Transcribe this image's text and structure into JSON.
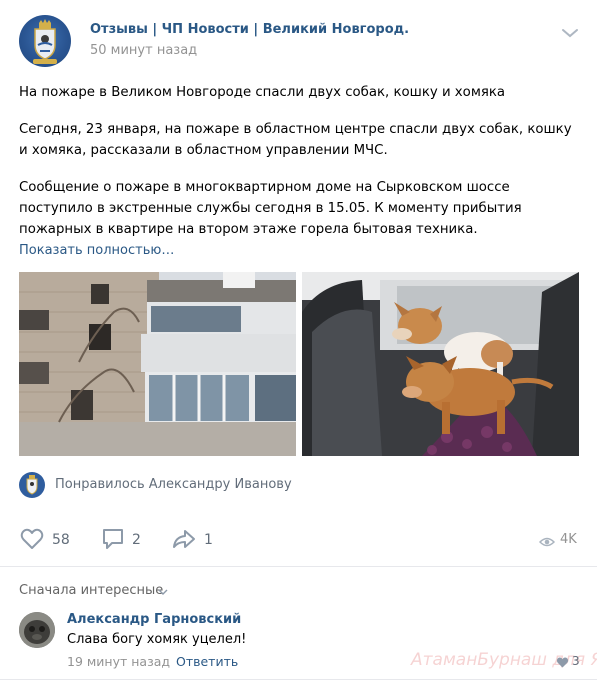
{
  "post": {
    "group_name": "Отзывы | ЧП Новости | Великий Новгород.",
    "time": "50 минут назад",
    "paragraphs": [
      "На пожаре в Великом Новгороде спасли двух собак, кошку и хомяка",
      "Сегодня, 23 января, на пожаре в областном центре спасли двух собак, кошку и хомяка, рассказали в областном управлении МЧС.",
      "Сообщение о пожаре в многоквартирном доме на Сырковском шоссе поступило в экстренные службы сегодня в 15.05. К моменту прибытия пожарных в квартире на втором этаже горела бытовая техника."
    ],
    "show_more": "Показать полностью…",
    "photos": [
      {
        "icon": "burned-building-photo"
      },
      {
        "icon": "dogs-in-car-photo"
      }
    ],
    "liked_by": "Понравилось Александру Иванову"
  },
  "actions": {
    "likes": "58",
    "comments": "2",
    "shares": "1",
    "views": "4K"
  },
  "comments": {
    "sort_label": "Сначала интересные",
    "items": [
      {
        "author": "Александр Гарновский",
        "text": "Слава богу хомяк уцелел!",
        "time": "19 минут назад",
        "reply": "Ответить",
        "likes": "3"
      }
    ]
  },
  "watermark": "АтаманБурнаш для Я",
  "colors": {
    "link": "#2a5885",
    "muted": "#939393",
    "action": "#626d7a"
  }
}
